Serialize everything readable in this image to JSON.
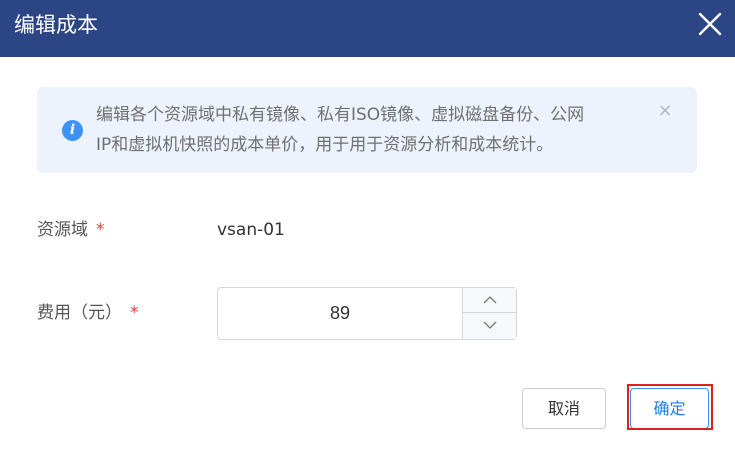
{
  "dialog": {
    "title": "编辑成本",
    "close_icon": "close-icon"
  },
  "alert": {
    "icon": "info-icon",
    "icon_glyph": "i",
    "line1": "编辑各个资源域中私有镜像、私有ISO镜像、虚拟磁盘备份、公网",
    "line2": "IP和虚拟机快照的成本单价，用于用于资源分析和成本统计。",
    "close_glyph": "×"
  },
  "form": {
    "domain_label": "资源域",
    "domain_value": "vsan-01",
    "cost_label": "费用（元）",
    "cost_value": "89",
    "required_mark": "*"
  },
  "buttons": {
    "cancel": "取消",
    "confirm": "确定"
  },
  "colors": {
    "header_bg": "#2b4585",
    "alert_bg": "#ecf3fd",
    "info_icon": "#3d93f5",
    "required": "#e23b3b",
    "confirm_text": "#1f7ee8",
    "highlight_border": "#e01f1f"
  }
}
